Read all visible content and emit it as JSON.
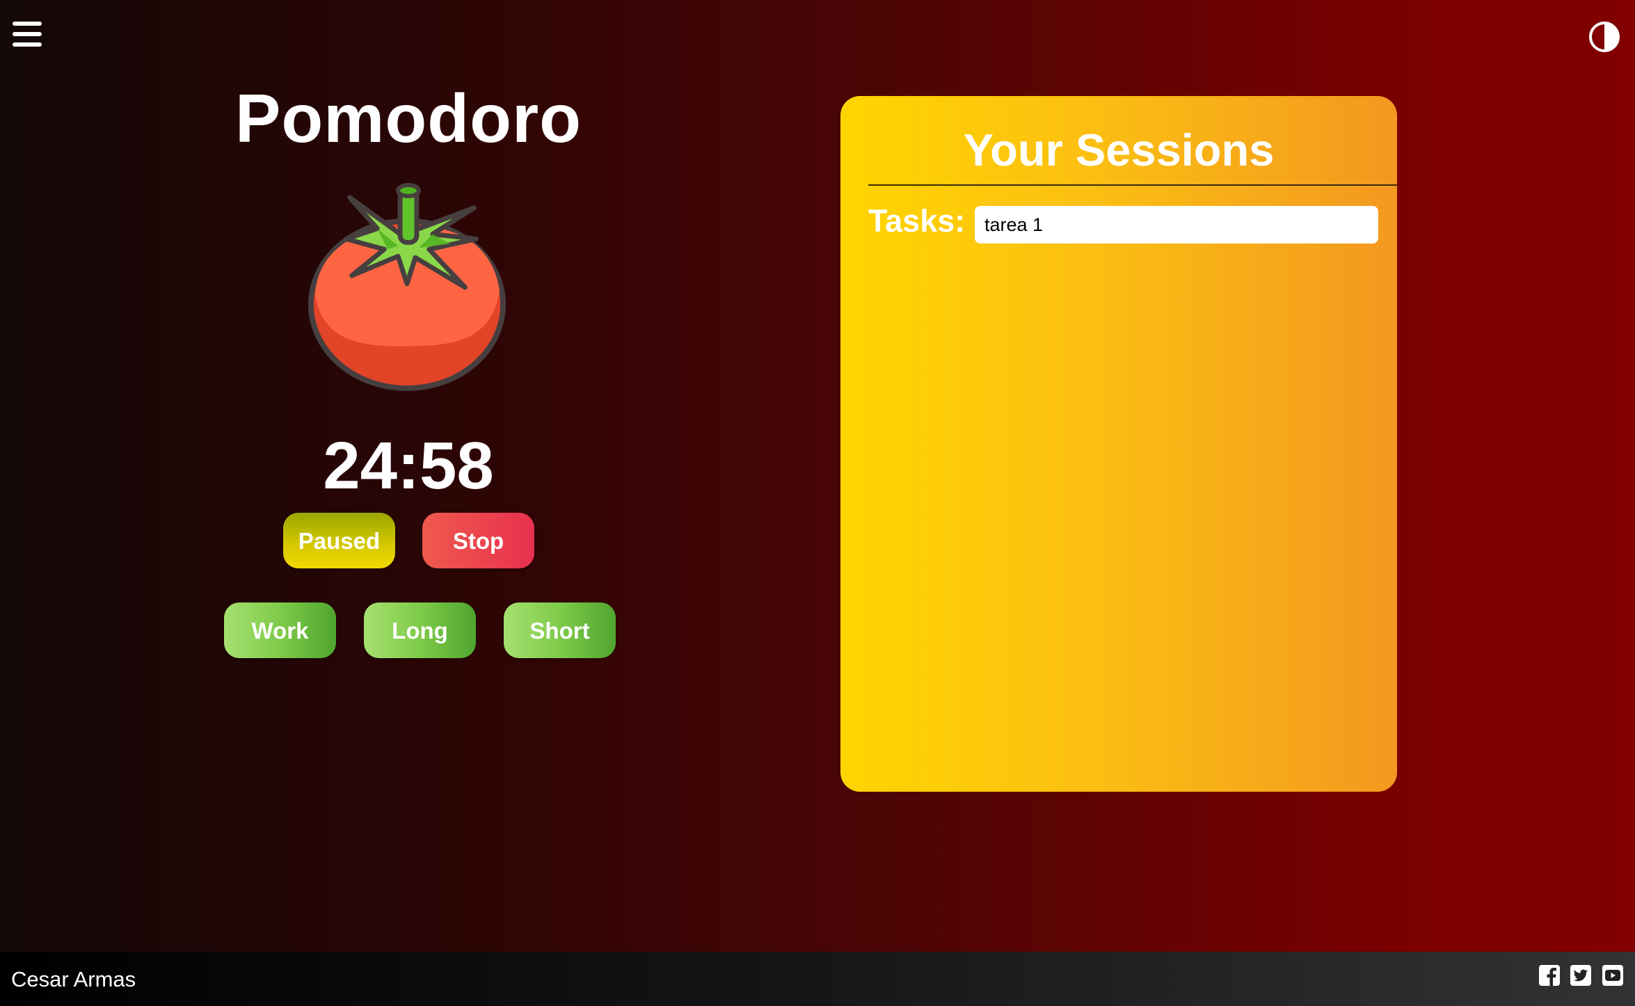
{
  "header": {
    "menu_icon": "hamburger-menu-icon",
    "theme_icon": "contrast-toggle-icon"
  },
  "timer": {
    "title": "Pomodoro",
    "time": "24:58",
    "paused_label": "Paused",
    "stop_label": "Stop",
    "modes": [
      "Work",
      "Long",
      "Short"
    ]
  },
  "sessions": {
    "title": "Your Sessions",
    "tasks_label": "Tasks:",
    "task_value": "tarea 1"
  },
  "footer": {
    "author": "Cesar Armas",
    "social_icons": [
      "facebook-icon",
      "twitter-icon",
      "youtube-icon"
    ]
  },
  "colors": {
    "background_start": "#140808",
    "background_end": "#820000",
    "panel_start": "#ffd500",
    "panel_end": "#f39820",
    "stop_button": "#e8314f",
    "mode_button": "#7fcb4a",
    "paused_button": "#d7c900"
  }
}
